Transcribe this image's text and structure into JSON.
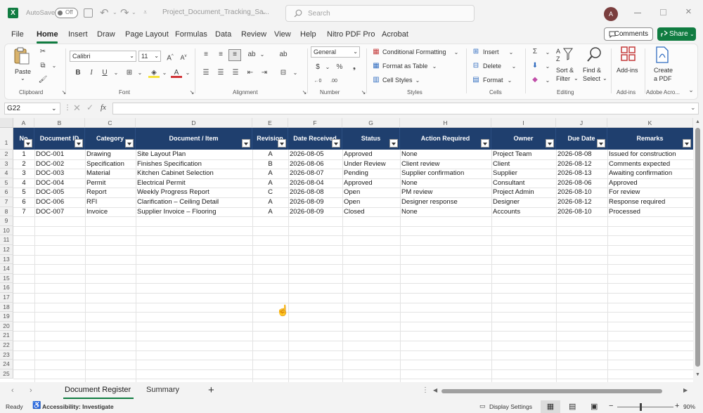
{
  "titlebar": {
    "autosave_label": "AutoSave",
    "autosave_state": "Off",
    "doc_title": "Project_Document_Tracking_Sa...",
    "search_placeholder": "Search",
    "avatar_initial": "A"
  },
  "menu": {
    "tabs": [
      "File",
      "Home",
      "Insert",
      "Draw",
      "Page Layout",
      "Formulas",
      "Data",
      "Review",
      "View",
      "Help",
      "Nitro PDF Pro",
      "Acrobat"
    ],
    "active": "Home",
    "comments_label": "Comments",
    "share_label": "Share"
  },
  "ribbon": {
    "clipboard": {
      "paste": "Paste",
      "label": "Clipboard"
    },
    "font": {
      "name": "Calibri",
      "size": "11",
      "label": "Font",
      "bold": "B",
      "italic": "I",
      "underline": "U"
    },
    "alignment": {
      "label": "Alignment"
    },
    "number": {
      "format": "General",
      "label": "Number"
    },
    "styles": {
      "conditional": "Conditional Formatting",
      "table": "Format as Table",
      "cell_styles": "Cell Styles",
      "label": "Styles"
    },
    "cells": {
      "insert": "Insert",
      "delete": "Delete",
      "format": "Format",
      "label": "Cells"
    },
    "editing": {
      "sort_filter": "Sort &",
      "sort_filter2": "Filter",
      "find_select": "Find &",
      "find_select2": "Select",
      "label": "Editing"
    },
    "addins": {
      "button": "Add-ins",
      "label": "Add-ins"
    },
    "acrobat": {
      "button1": "Create",
      "button2": "a PDF",
      "label": "Adobe Acro..."
    }
  },
  "formula_bar": {
    "name_box": "G22",
    "fx": "fx",
    "content": ""
  },
  "columns": [
    "A",
    "B",
    "C",
    "D",
    "E",
    "F",
    "G",
    "H",
    "I",
    "J",
    "K"
  ],
  "table": {
    "headers": [
      "No",
      "Document ID",
      "Category",
      "Document / Item",
      "Revision",
      "Date Received",
      "Status",
      "Action Required",
      "Owner",
      "Due Date",
      "Remarks"
    ],
    "rows": [
      [
        "1",
        "DOC-001",
        "Drawing",
        "Site Layout Plan",
        "A",
        "2026-08-05",
        "Approved",
        "None",
        "Project Team",
        "2026-08-08",
        "Issued for construction"
      ],
      [
        "2",
        "DOC-002",
        "Specification",
        "Finishes Specification",
        "B",
        "2026-08-06",
        "Under Review",
        "Client review",
        "Client",
        "2026-08-12",
        "Comments expected"
      ],
      [
        "3",
        "DOC-003",
        "Material",
        "Kitchen Cabinet Selection",
        "A",
        "2026-08-07",
        "Pending",
        "Supplier confirmation",
        "Supplier",
        "2026-08-13",
        "Awaiting confirmation"
      ],
      [
        "4",
        "DOC-004",
        "Permit",
        "Electrical Permit",
        "A",
        "2026-08-04",
        "Approved",
        "None",
        "Consultant",
        "2026-08-06",
        "Approved"
      ],
      [
        "5",
        "DOC-005",
        "Report",
        "Weekly Progress Report",
        "C",
        "2026-08-08",
        "Open",
        "PM review",
        "Project Admin",
        "2026-08-10",
        "For review"
      ],
      [
        "6",
        "DOC-006",
        "RFI",
        "Clarification – Ceiling Detail",
        "A",
        "2026-08-09",
        "Open",
        "Designer response",
        "Designer",
        "2026-08-12",
        "Response required"
      ],
      [
        "7",
        "DOC-007",
        "Invoice",
        "Supplier Invoice – Flooring",
        "A",
        "2026-08-09",
        "Closed",
        "None",
        "Accounts",
        "2026-08-10",
        "Processed"
      ]
    ]
  },
  "row_numbers": [
    "1",
    "2",
    "3",
    "4",
    "5",
    "6",
    "7",
    "8",
    "9",
    "10",
    "11",
    "12",
    "13",
    "14",
    "15",
    "16",
    "17",
    "18",
    "19",
    "20",
    "21",
    "22",
    "23",
    "24",
    "25"
  ],
  "sheets": {
    "tabs": [
      "Document Register",
      "Summary"
    ],
    "active": "Document Register",
    "add": "+"
  },
  "status": {
    "ready": "Ready",
    "accessibility": "Accessibility: Investigate",
    "display_settings": "Display Settings",
    "zoom": "90%"
  },
  "colors": {
    "header_fill": "#1f3f6e",
    "accent": "#107c41"
  }
}
